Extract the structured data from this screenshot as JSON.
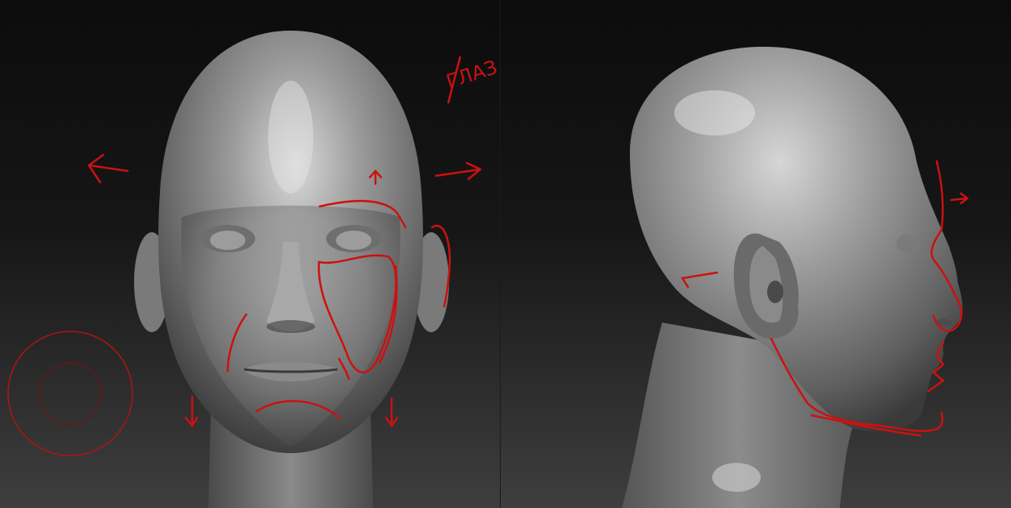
{
  "scene": {
    "background_top": "#0c0c0c",
    "background_bottom": "#3c3c3c",
    "clay_color": "#8e8e8e",
    "paintover_color": "#cc1111",
    "brush_cursor_color": "#b01414"
  },
  "annotations": {
    "handwritten_note": "ГЛАЗ"
  },
  "views": [
    {
      "name": "front-view"
    },
    {
      "name": "side-view"
    }
  ]
}
